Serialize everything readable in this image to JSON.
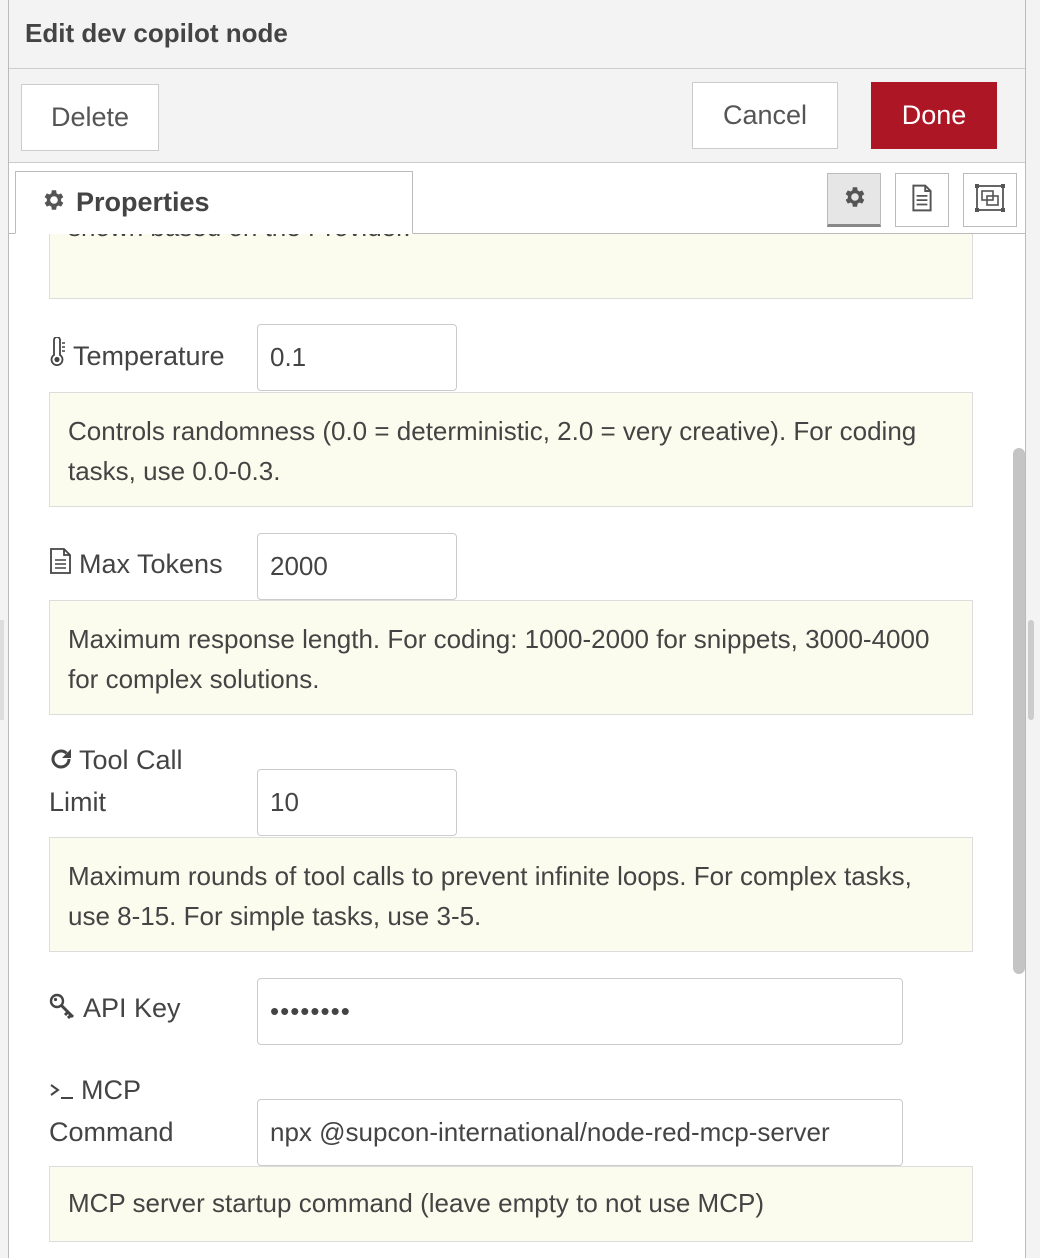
{
  "tray": {
    "title": "Edit dev copilot node"
  },
  "toolbar": {
    "delete_label": "Delete",
    "cancel_label": "Cancel",
    "done_label": "Done"
  },
  "tabs": {
    "properties_label": "Properties"
  },
  "colors": {
    "done_bg": "#ad1625",
    "tip_bg": "#fcfcee",
    "border": "#cccccc"
  },
  "form": {
    "top_tip": "shown based on the Provider.",
    "temperature": {
      "label": "Temperature",
      "value": "0.1",
      "tip": "Controls randomness (0.0 = deterministic, 2.0 = very creative). For coding tasks, use 0.0-0.3."
    },
    "max_tokens": {
      "label": "Max Tokens",
      "value": "2000",
      "tip": "Maximum response length. For coding: 1000-2000 for snippets, 3000-4000 for complex solutions."
    },
    "tool_call_limit": {
      "label_line1": "Tool Call",
      "label_line2": "Limit",
      "value": "10",
      "tip": "Maximum rounds of tool calls to prevent infinite loops. For complex tasks, use 8-15. For simple tasks, use 3-5."
    },
    "api_key": {
      "label": "API Key",
      "value": "••••••••"
    },
    "mcp_command": {
      "label_line1": "MCP",
      "label_line2": "Command",
      "value": "npx @supcon-international/node-red-mcp-server",
      "tip": "MCP server startup command (leave empty to not use MCP)"
    }
  },
  "icons": {
    "tab": "gear-icon",
    "temperature": "thermometer-icon",
    "max_tokens": "file-text-icon",
    "tool_call_limit": "refresh-icon",
    "api_key": "key-icon",
    "mcp_command": "terminal-icon",
    "tab_buttons": [
      "gear-icon",
      "file-text-icon",
      "object-group-icon"
    ]
  }
}
